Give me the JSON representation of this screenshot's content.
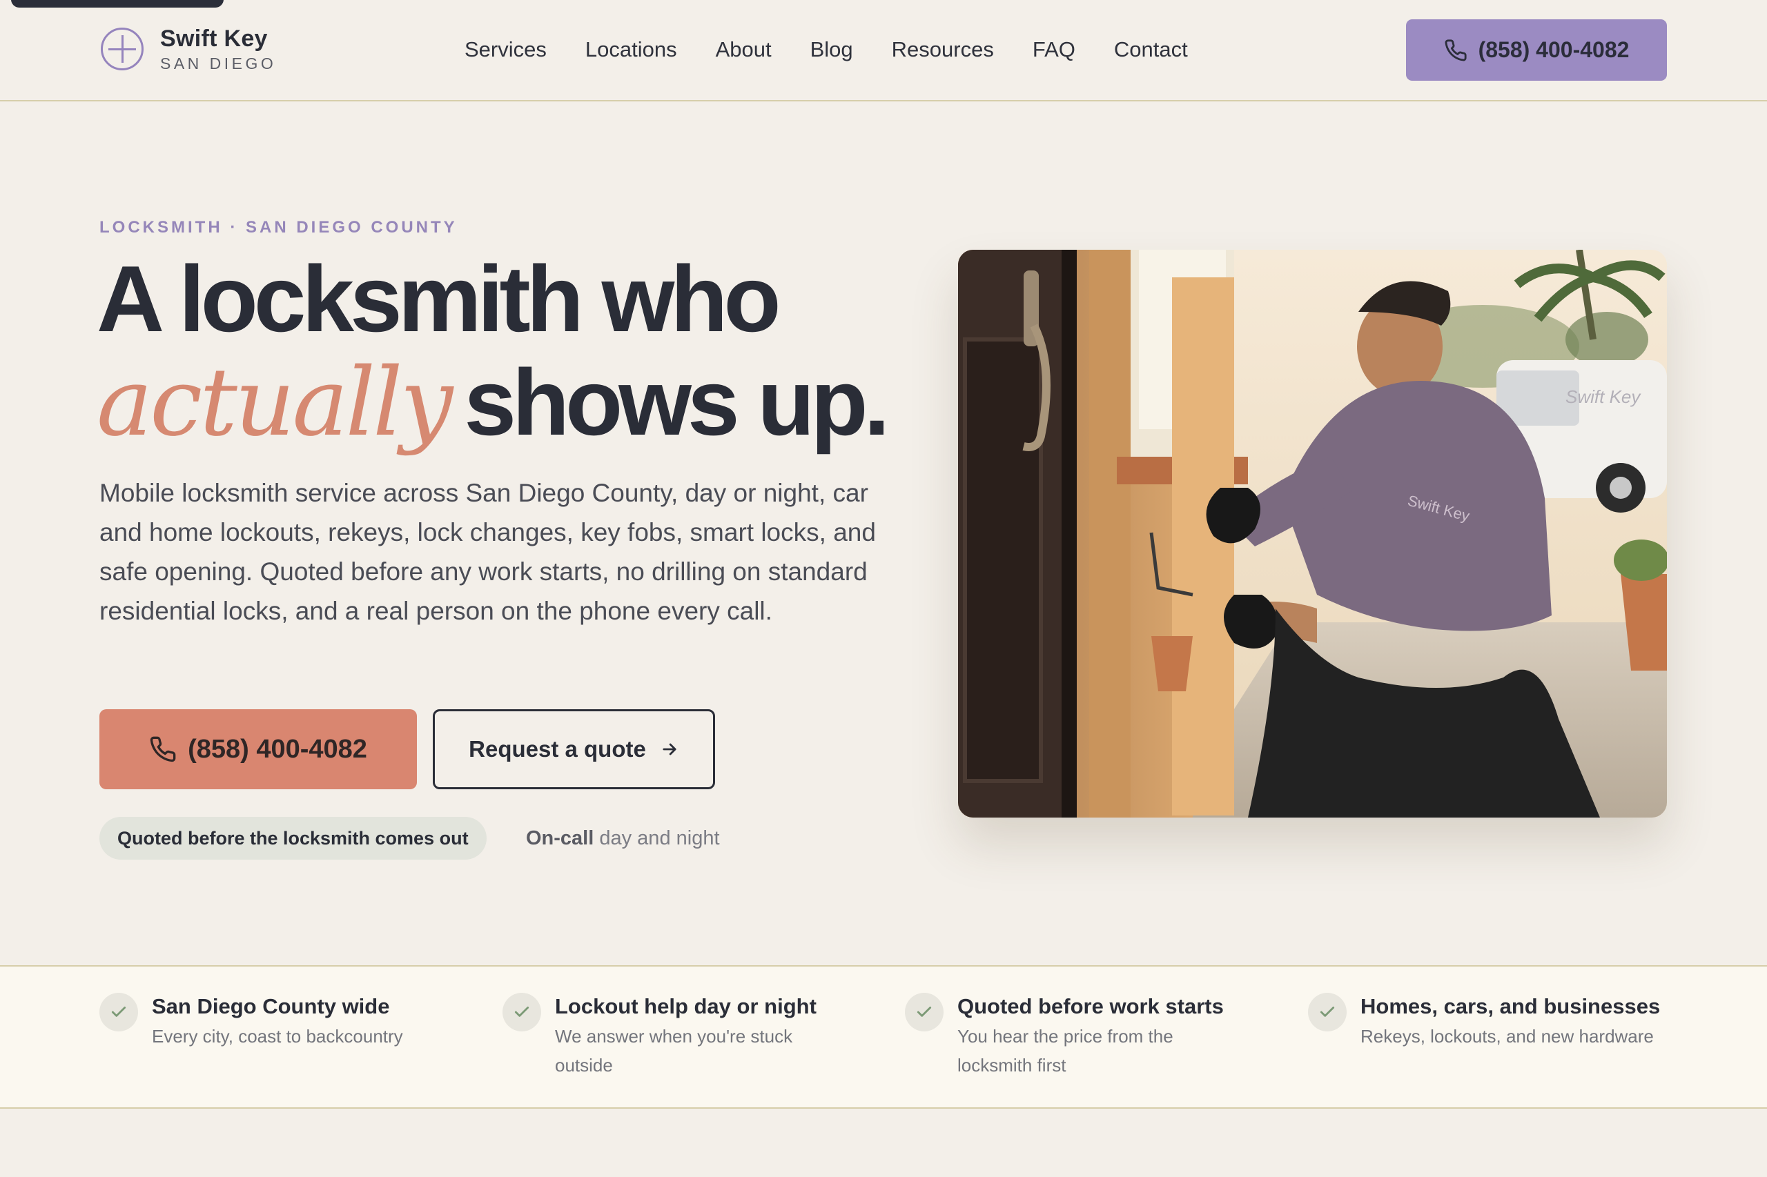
{
  "brand": {
    "name": "Swift Key",
    "sub": "SAN DIEGO"
  },
  "nav": [
    "Services",
    "Locations",
    "About",
    "Blog",
    "Resources",
    "FAQ",
    "Contact"
  ],
  "header_phone": "(858) 400-4082",
  "hero": {
    "eyebrow": "LOCKSMITH · SAN DIEGO COUNTY",
    "title_line1": "A locksmith who",
    "title_accent": "actually",
    "title_line2_rest": "shows up.",
    "lede": "Mobile locksmith service across San Diego County, day or night, car and home lockouts, rekeys, lock changes, key fobs, smart locks, and safe opening. Quoted before any work starts, no drilling on standard residential locks, and a real person on the phone every call.",
    "cta_phone": "(858) 400-4082",
    "cta_quote": "Request a quote",
    "badge": "Quoted before the locksmith comes out",
    "oncall_bold": "On-call",
    "oncall_rest": " day and night",
    "van_text": "Swift Key",
    "shirt_text": "Swift Key"
  },
  "features": [
    {
      "title": "San Diego County wide",
      "desc": "Every city, coast to backcountry"
    },
    {
      "title": "Lockout help day or night",
      "desc": "We answer when you're stuck outside"
    },
    {
      "title": "Quoted before work starts",
      "desc": "You hear the price from the locksmith first"
    },
    {
      "title": "Homes, cars, and businesses",
      "desc": "Rekeys, lockouts, and new hardware"
    }
  ],
  "colors": {
    "accent_purple": "#9b8bc2",
    "accent_coral": "#d98670",
    "ink": "#2a2d37",
    "background": "#f3efe9"
  }
}
